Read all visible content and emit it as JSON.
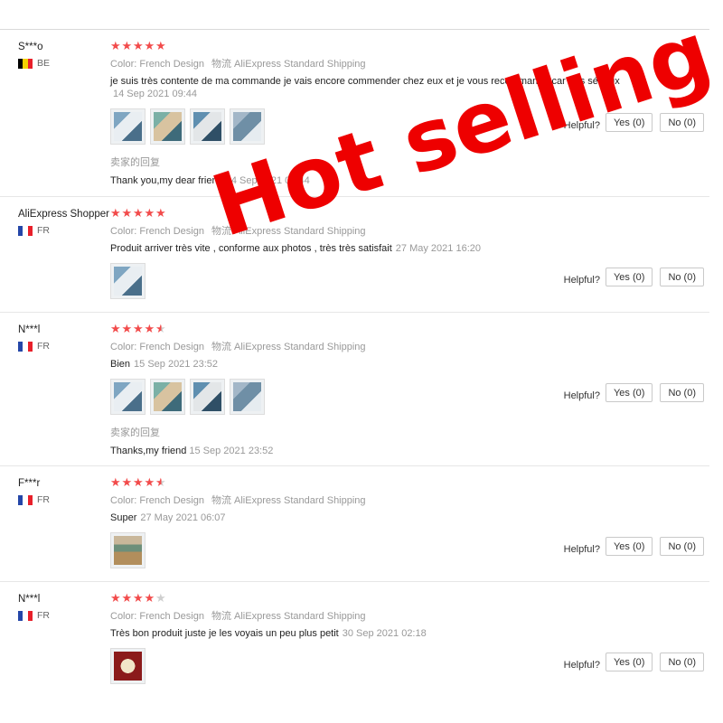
{
  "colors": {
    "star": "#f24b4b",
    "star_empty": "#cfcfcf",
    "overlay": "#ee0000"
  },
  "overlay_text": "Hot selling",
  "helpful_label": "Helpful?",
  "reviews": [
    {
      "name": "S***o",
      "country": "BE",
      "flag": [
        "#000000",
        "#f5d100",
        "#e8202a"
      ],
      "rating": 5,
      "color_label": "Color: ",
      "color_value": "French Design",
      "shipping": "物流 AliExpress Standard Shipping",
      "text": "je suis très contente de ma commande je vais encore commender chez eux et je vous recommande car très sérieux",
      "date": "14 Sep 2021 09:44",
      "photos": [
        "photo-1",
        "photo-2",
        "photo-3",
        "photo-4"
      ],
      "seller_reply_title": "卖家的回复",
      "seller_reply": "Thank you,my dear friend",
      "seller_reply_date": "14 Sep 2021 09:44",
      "yes": "Yes (0)",
      "no": "No (0)"
    },
    {
      "name": "AliExpress Shopper",
      "country": "FR",
      "flag": [
        "#2446a8",
        "#ffffff",
        "#e8202a"
      ],
      "rating": 5,
      "color_label": "Color: ",
      "color_value": "French Design",
      "shipping": "物流 AliExpress Standard Shipping",
      "text": "Produit arriver très vite , conforme aux photos , très très satisfait",
      "date": "27 May 2021 16:20",
      "photos": [
        "photo-1"
      ],
      "yes": "Yes (0)",
      "no": "No (0)"
    },
    {
      "name": "N***l",
      "country": "FR",
      "flag": [
        "#2446a8",
        "#ffffff",
        "#e8202a"
      ],
      "rating": 4.5,
      "color_label": "Color: ",
      "color_value": "French Design",
      "shipping": "物流 AliExpress Standard Shipping",
      "text": "Bien",
      "date": "15 Sep 2021 23:52",
      "photos": [
        "photo-1",
        "photo-2",
        "photo-3",
        "photo-4"
      ],
      "seller_reply_title": "卖家的回复",
      "seller_reply": "Thanks,my friend",
      "seller_reply_date": "15 Sep 2021 23:52",
      "yes": "Yes (0)",
      "no": "No (0)"
    },
    {
      "name": "F***r",
      "country": "FR",
      "flag": [
        "#2446a8",
        "#ffffff",
        "#e8202a"
      ],
      "rating": 4.5,
      "color_label": "Color: ",
      "color_value": "French Design",
      "shipping": "物流 AliExpress Standard Shipping",
      "text": "Super",
      "date": "27 May 2021 06:07",
      "photos": [
        "photo-1"
      ],
      "yes": "Yes (0)",
      "no": "No (0)"
    },
    {
      "name": "N***l",
      "country": "FR",
      "flag": [
        "#2446a8",
        "#ffffff",
        "#e8202a"
      ],
      "rating": 4,
      "color_label": "Color: ",
      "color_value": "French Design",
      "shipping": "物流 AliExpress Standard Shipping",
      "text": "Très bon produit juste je les voyais un peu plus petit",
      "date": "30 Sep 2021 02:18",
      "photos": [
        "photo-1"
      ],
      "yes": "Yes (0)",
      "no": "No (0)"
    }
  ]
}
